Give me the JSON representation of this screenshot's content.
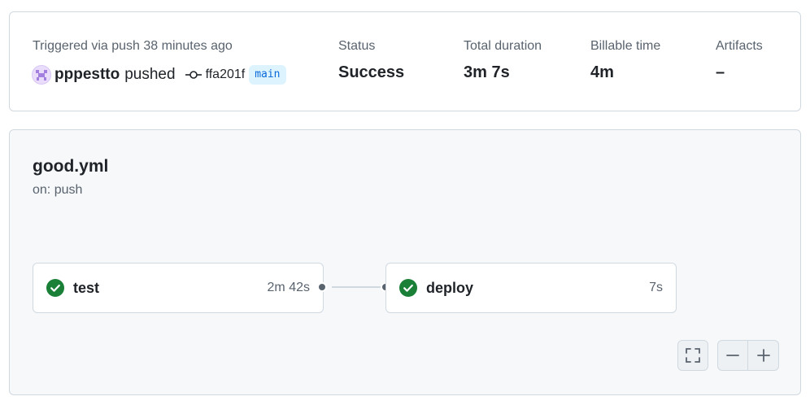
{
  "summary": {
    "trigger_text": "Triggered via push 38 minutes ago",
    "actor": "pppestto",
    "action": "pushed",
    "commit_sha": "ffa201f",
    "branch": "main",
    "stats": [
      {
        "label": "Status",
        "value": "Success"
      },
      {
        "label": "Total duration",
        "value": "3m 7s"
      },
      {
        "label": "Billable time",
        "value": "4m"
      },
      {
        "label": "Artifacts",
        "value": "–"
      }
    ]
  },
  "workflow": {
    "file": "good.yml",
    "trigger": "on: push",
    "jobs": [
      {
        "name": "test",
        "duration": "2m 42s",
        "status": "success"
      },
      {
        "name": "deploy",
        "duration": "7s",
        "status": "success"
      }
    ]
  },
  "colors": {
    "success": "#1a7f37",
    "accent": "#0969da"
  },
  "icons": {
    "status": "check-circle-icon",
    "commit": "git-commit-icon",
    "fullscreen": "fullscreen-icon",
    "zoom_out": "minus-icon",
    "zoom_in": "plus-icon"
  }
}
